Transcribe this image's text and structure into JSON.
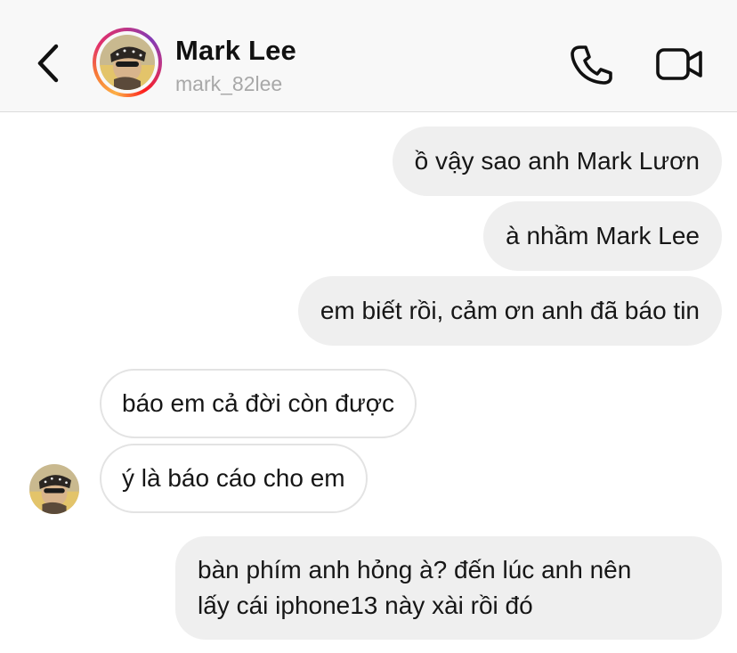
{
  "header": {
    "name": "Mark Lee",
    "username": "mark_82lee",
    "back_icon": "chevron-left-icon",
    "call_icon": "phone-icon",
    "video_icon": "video-camera-icon",
    "story_ring_colors": [
      "#fcaf45",
      "#f77737",
      "#e1306c",
      "#c13584",
      "#833ab4"
    ]
  },
  "messages": [
    {
      "direction": "outgoing",
      "text": "ồ vậy sao anh Mark Lươn"
    },
    {
      "direction": "outgoing",
      "text": "à nhầm Mark Lee"
    },
    {
      "direction": "outgoing",
      "text": "em biết rồi, cảm ơn anh đã báo tin"
    },
    {
      "direction": "incoming",
      "text": "báo em cả đời còn được"
    },
    {
      "direction": "incoming",
      "text": "ý là báo cáo cho em"
    },
    {
      "direction": "outgoing",
      "lines": [
        "bàn phím anh hỏng à? đến lúc anh nên",
        "lấy cái iphone13 này xài rồi đó"
      ]
    }
  ],
  "colors": {
    "outgoing_bubble": "#efefef",
    "incoming_border": "#e3e3e3",
    "header_bg": "#f8f8f8",
    "handle_text": "#a8a8a8"
  }
}
